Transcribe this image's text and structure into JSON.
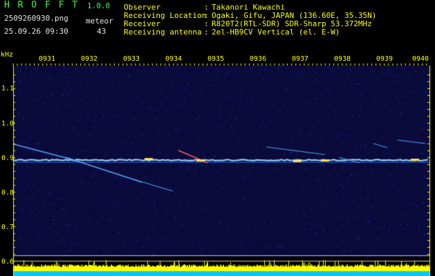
{
  "header": {
    "app_name": "H R O F F T",
    "app_version": "1.0.0",
    "filename": "2509260930.png",
    "datetime": "25.09.26 09:30",
    "meteor_label": "meteor",
    "meteor_count": "43",
    "info_labels": [
      "Observer",
      "Receiving Location",
      "Receiver",
      "Receiving antenna"
    ],
    "info_colons": [
      ":",
      ":",
      ":",
      ":"
    ],
    "info_values": [
      "Takanori Kawachi",
      "Ogaki, Gifu, JAPAN (136.60E, 35.35N)",
      "R820T2(RTL-SDR) SDR-Sharp 53.372MHz",
      "2el-HB9CV Vertical (el. E-W)"
    ]
  },
  "spectrogram": {
    "y_unit": "kHz",
    "y_ticks": [
      "1.1",
      "1.0",
      "0.9",
      "0.8",
      "0.7",
      "0.6"
    ],
    "x_ticks": [
      "0931",
      "0932",
      "0933",
      "0934",
      "0935",
      "0936",
      "0937",
      "0938",
      "0939",
      "0940"
    ],
    "colors": {
      "background": "#0a0a3a",
      "carrier": "#9fd8ff",
      "meteor": "#ffe050",
      "level_bar": "#ffff00",
      "level_base": "#00c8ff",
      "axis": "#ffff00"
    }
  }
}
